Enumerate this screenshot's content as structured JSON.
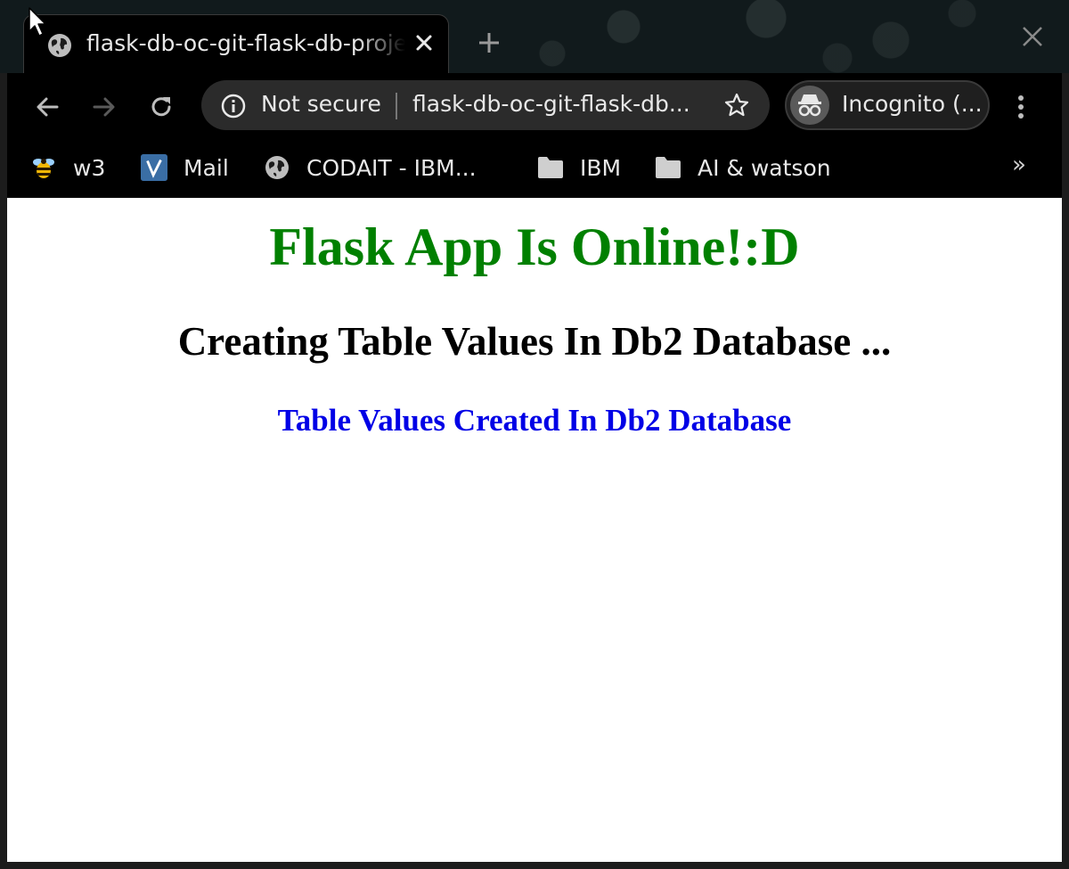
{
  "browser": {
    "tab": {
      "title": "flask-db-oc-git-flask-db-project",
      "favicon": "globe-icon"
    },
    "omnibox": {
      "security_label": "Not secure",
      "url": "flask-db-oc-git-flask-db..."
    },
    "profile": {
      "label": "Incognito (..."
    },
    "bookmarks": [
      {
        "label": "w3",
        "icon": "bee-icon"
      },
      {
        "label": "Mail",
        "icon": "mail-icon"
      },
      {
        "label": "CODAIT - IBM...",
        "icon": "globe-icon"
      },
      {
        "label": "IBM",
        "icon": "folder-icon"
      },
      {
        "label": "AI & watson",
        "icon": "folder-icon"
      }
    ],
    "bookmarks_overflow": "»"
  },
  "page": {
    "heading": "Flask App Is Online!:D",
    "subheading": "Creating Table Values In Db2 Database ...",
    "status": "Table Values Created In Db2 Database"
  },
  "colors": {
    "heading": "#008000",
    "subheading": "#000000",
    "status": "#0000e6",
    "chrome_dark": "#000000"
  }
}
